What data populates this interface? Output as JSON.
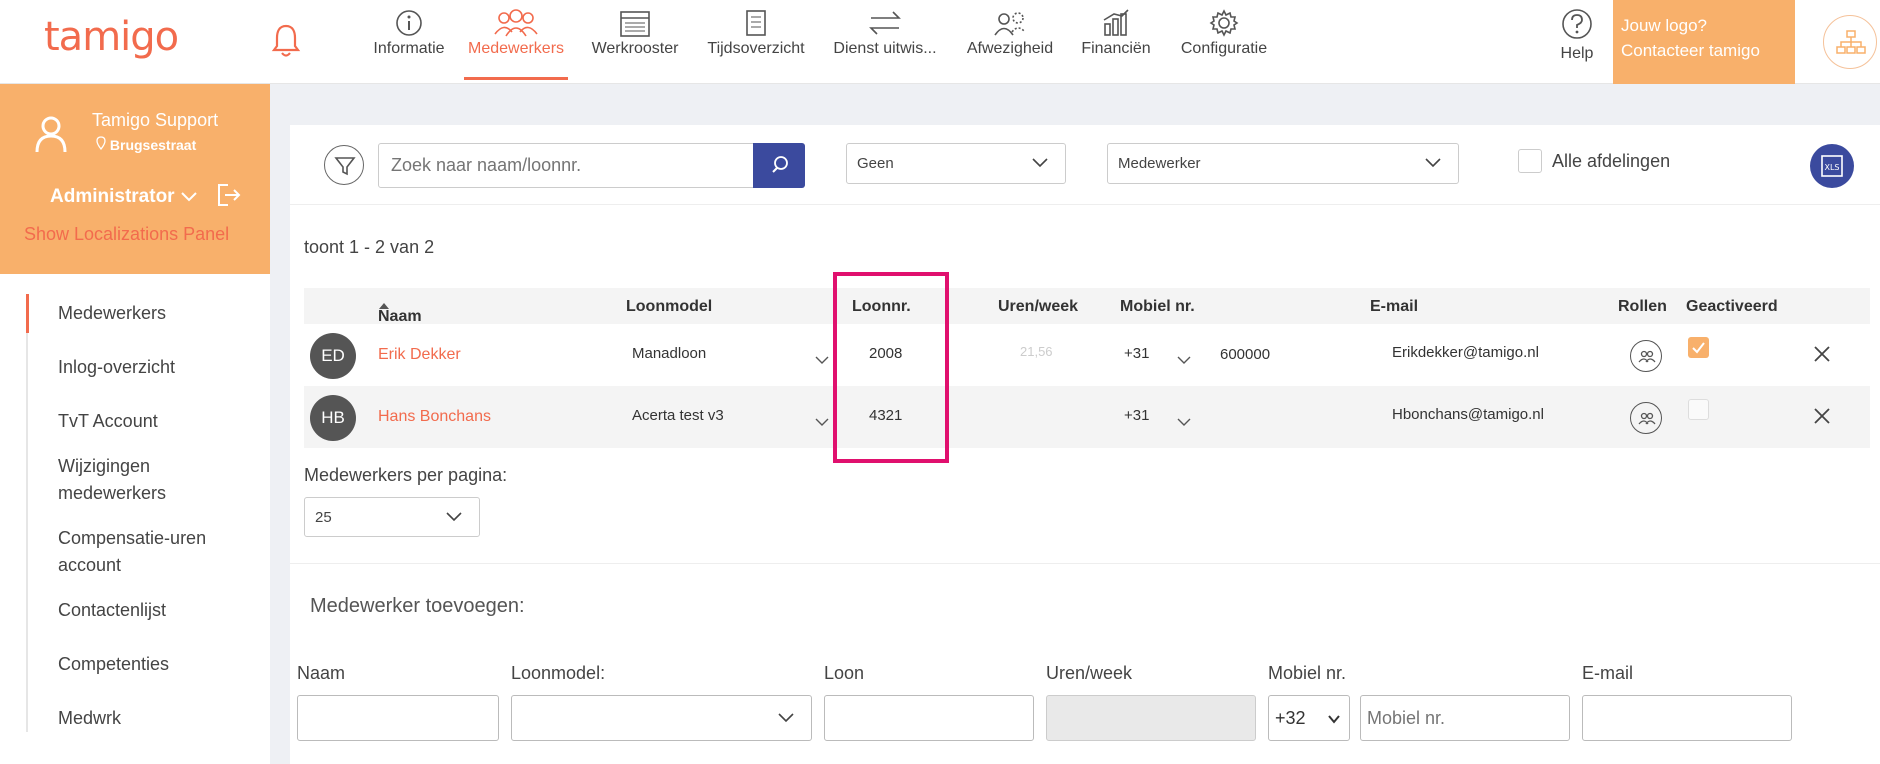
{
  "app": {
    "logo": "tamigo"
  },
  "nav": [
    {
      "label": "Informatie",
      "icon": "info-icon",
      "active": false
    },
    {
      "label": "Medewerkers",
      "icon": "employees-icon",
      "active": true
    },
    {
      "label": "Werkrooster",
      "icon": "schedule-icon",
      "active": false
    },
    {
      "label": "Tijdsoverzicht",
      "icon": "timesheet-icon",
      "active": false
    },
    {
      "label": "Dienst uitwis...",
      "icon": "swap-icon",
      "active": false
    },
    {
      "label": "Afwezigheid",
      "icon": "absence-icon",
      "active": false
    },
    {
      "label": "Financiën",
      "icon": "finance-icon",
      "active": false
    },
    {
      "label": "Configuratie",
      "icon": "gear-icon",
      "active": false
    }
  ],
  "help_label": "Help",
  "logo_promo": {
    "line1": "Jouw logo?",
    "line2": "Contacteer tamigo"
  },
  "profile": {
    "name": "Tamigo Support",
    "location": "Brugsestraat",
    "role": "Administrator",
    "localizations_link": "Show Localizations Panel"
  },
  "sidebar": {
    "items": [
      {
        "label": "Medewerkers",
        "active": true
      },
      {
        "label": "Inlog-overzicht"
      },
      {
        "label": "TvT Account"
      },
      {
        "label": "Wijzigingen medewerkers"
      },
      {
        "label": "Compensatie-uren account"
      },
      {
        "label": "Contactenlijst"
      },
      {
        "label": "Competenties"
      },
      {
        "label": "Medwrk"
      }
    ]
  },
  "filters": {
    "search_placeholder": "Zoek naar naam/loonnr.",
    "select1": "Geen",
    "select2": "Medewerker",
    "all_departments": "Alle afdelingen",
    "export_label": "XLS"
  },
  "table": {
    "summary": "toont 1 - 2 van 2",
    "headers": {
      "name": "Naam",
      "pay_model": "Loonmodel",
      "pay_no": "Loonnr.",
      "hours_week": "Uren/week",
      "mobile": "Mobiel nr.",
      "email": "E-mail",
      "roles": "Rollen",
      "activated": "Geactiveerd"
    },
    "rows": [
      {
        "initials": "ED",
        "name": "Erik Dekker",
        "pay_model": "Manadloon",
        "pay_no": "2008",
        "hours_week": "21,56",
        "prefix": "+31",
        "mobile": "600000",
        "email": "Erikdekker@tamigo.nl",
        "activated": true
      },
      {
        "initials": "HB",
        "name": "Hans Bonchans",
        "pay_model": "Acerta test v3",
        "pay_no": "4321",
        "hours_week": "",
        "prefix": "+31",
        "mobile": "",
        "email": "Hbonchans@tamigo.nl",
        "activated": false
      }
    ],
    "per_page_label": "Medewerkers per pagina:",
    "per_page_value": "25"
  },
  "add_form": {
    "title": "Medewerker toevoegen:",
    "labels": {
      "name": "Naam",
      "pay_model": "Loonmodel:",
      "pay": "Loon",
      "hours_week": "Uren/week",
      "mobile": "Mobiel nr.",
      "email": "E-mail"
    },
    "country_code": "+32",
    "mobile_placeholder": "Mobiel nr."
  },
  "colors": {
    "accent": "#f26b4d",
    "orange_panel": "#f8b06b",
    "primary": "#3b4a9e",
    "highlight": "#e0106e"
  }
}
